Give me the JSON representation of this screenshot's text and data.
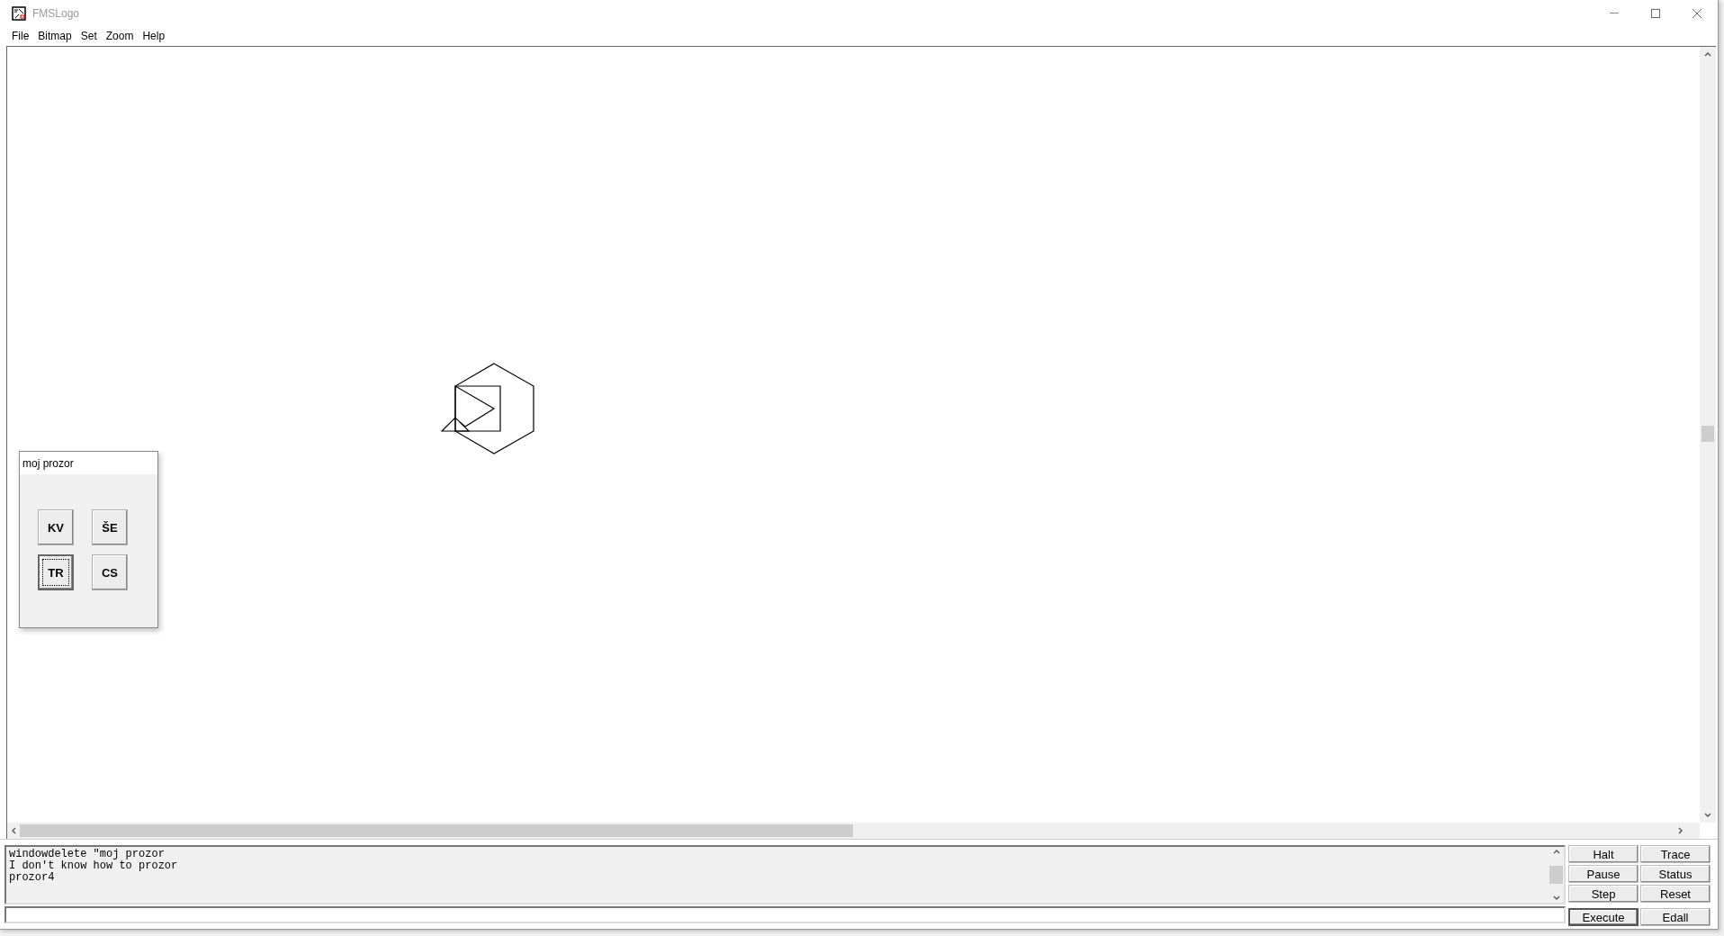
{
  "window": {
    "title": "FMSLogo"
  },
  "menu": [
    "File",
    "Bitmap",
    "Set",
    "Zoom",
    "Help"
  ],
  "dialog": {
    "title": "moj prozor",
    "buttons": [
      {
        "label": "KV",
        "focused": false
      },
      {
        "label": "ŠE",
        "focused": false
      },
      {
        "label": "TR",
        "focused": true
      },
      {
        "label": "CS",
        "focused": false
      }
    ]
  },
  "output": {
    "lines": [
      "windowdelete \"moj prozor",
      "I don't know how to prozor",
      "prozor4"
    ]
  },
  "commander_buttons": [
    {
      "label": "Halt",
      "default": false
    },
    {
      "label": "Trace",
      "default": false
    },
    {
      "label": "Pause",
      "default": false
    },
    {
      "label": "Status",
      "default": false
    },
    {
      "label": "Step",
      "default": false
    },
    {
      "label": "Reset",
      "default": false
    },
    {
      "label": "Execute",
      "default": true
    },
    {
      "label": "Edall",
      "default": false
    }
  ]
}
